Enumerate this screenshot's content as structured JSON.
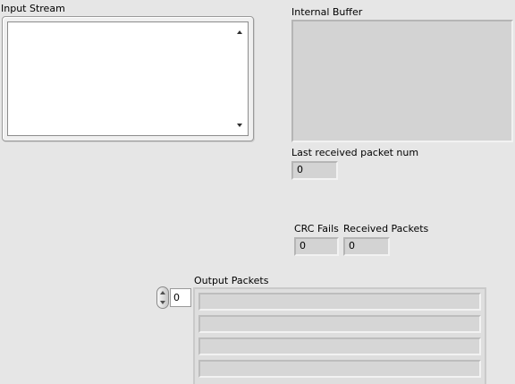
{
  "input_stream": {
    "label": "Input Stream",
    "value": ""
  },
  "internal_buffer": {
    "label": "Internal Buffer"
  },
  "last_received_packet_num": {
    "label": "Last received packet num",
    "value": "0"
  },
  "crc_fails": {
    "label": "CRC Fails",
    "value": "0"
  },
  "received_packets": {
    "label": "Received Packets",
    "value": "0"
  },
  "output_packets": {
    "label": "Output Packets",
    "index": "0",
    "rows": [
      "",
      "",
      "",
      ""
    ]
  }
}
